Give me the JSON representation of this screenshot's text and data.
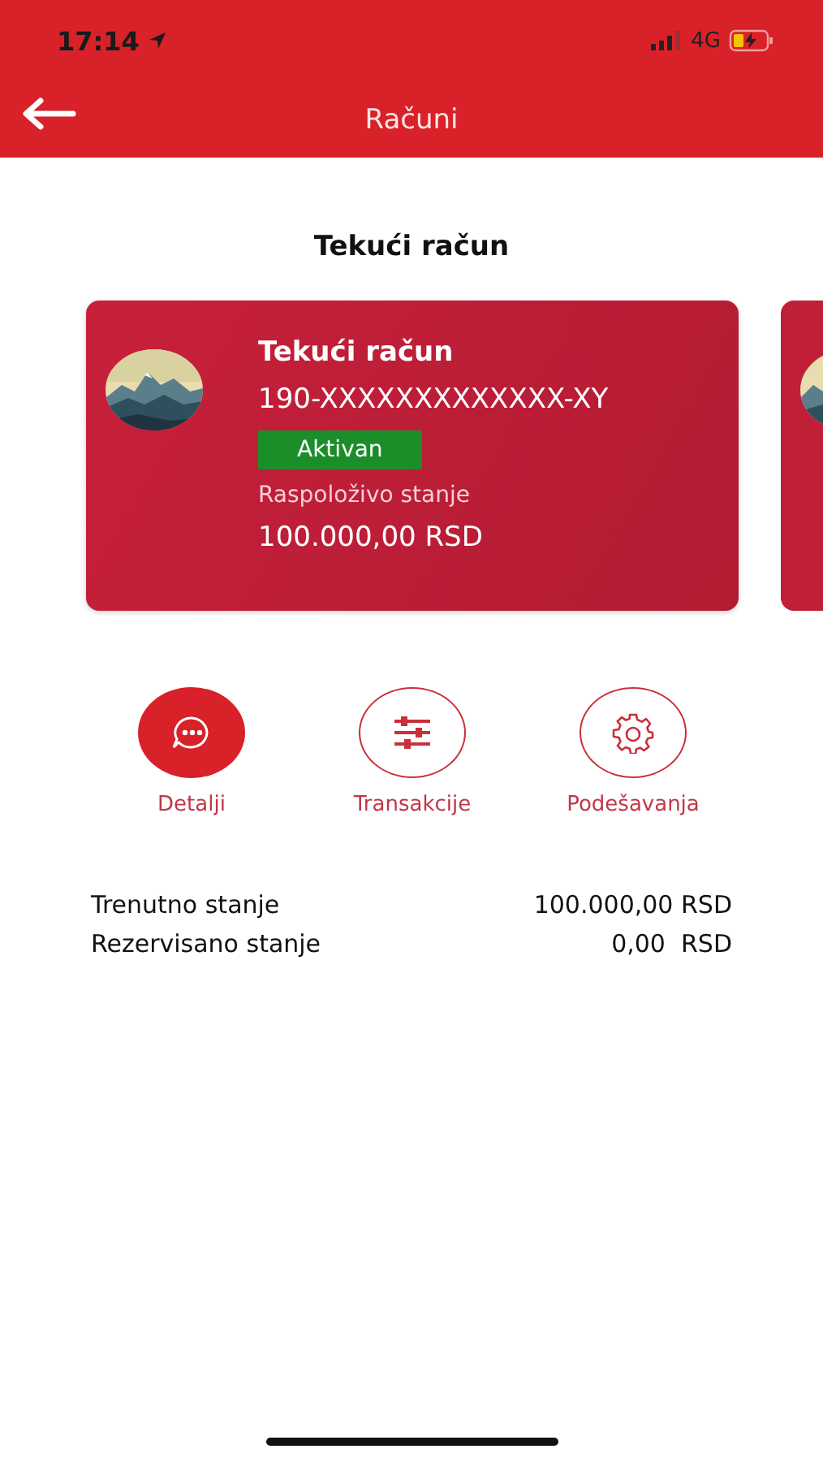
{
  "status_bar": {
    "time": "17:14",
    "network": "4G"
  },
  "header": {
    "title": "Računi"
  },
  "section_title": "Tekući račun",
  "account_card": {
    "name": "Tekući račun",
    "number": "190-XXXXXXXXXXXXX-XY",
    "status": "Aktivan",
    "active": true,
    "balance_label": "Raspoloživo stanje",
    "balance": "100.000,00 RSD"
  },
  "next_card_peek": true,
  "actions": [
    {
      "kind": "details",
      "label": "Detalji",
      "selected": true
    },
    {
      "kind": "transactions",
      "label": "Transakcije",
      "selected": false
    },
    {
      "kind": "settings",
      "label": "Podešavanja",
      "selected": false
    }
  ],
  "balances": [
    {
      "label": "Trenutno stanje",
      "value": "100.000,00 RSD"
    },
    {
      "label": "Rezervisano stanje",
      "value": "0,00  RSD"
    }
  ]
}
